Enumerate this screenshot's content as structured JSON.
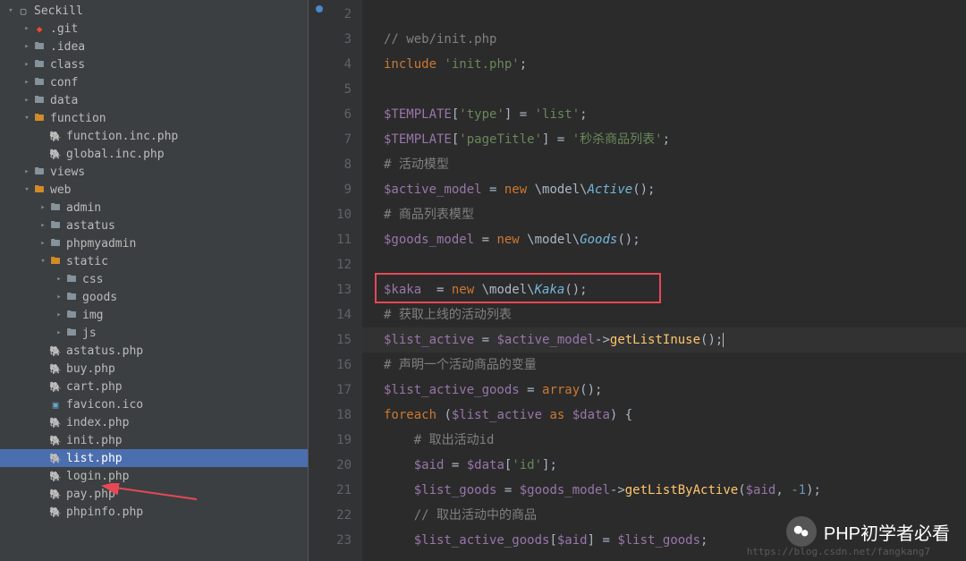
{
  "sidebar": {
    "items": [
      {
        "depth": 0,
        "chev": "open",
        "icon": "project",
        "label": "Seckill"
      },
      {
        "depth": 1,
        "chev": "closed",
        "icon": "git",
        "label": ".git"
      },
      {
        "depth": 1,
        "chev": "closed",
        "icon": "folder",
        "label": ".idea"
      },
      {
        "depth": 1,
        "chev": "closed",
        "icon": "folder",
        "label": "class"
      },
      {
        "depth": 1,
        "chev": "closed",
        "icon": "folder",
        "label": "conf"
      },
      {
        "depth": 1,
        "chev": "closed",
        "icon": "folder",
        "label": "data"
      },
      {
        "depth": 1,
        "chev": "open",
        "icon": "folder-open",
        "label": "function"
      },
      {
        "depth": 2,
        "chev": "none",
        "icon": "php",
        "label": "function.inc.php"
      },
      {
        "depth": 2,
        "chev": "none",
        "icon": "php",
        "label": "global.inc.php"
      },
      {
        "depth": 1,
        "chev": "closed",
        "icon": "folder",
        "label": "views"
      },
      {
        "depth": 1,
        "chev": "open",
        "icon": "folder-open",
        "label": "web"
      },
      {
        "depth": 2,
        "chev": "closed",
        "icon": "folder",
        "label": "admin"
      },
      {
        "depth": 2,
        "chev": "closed",
        "icon": "folder",
        "label": "astatus"
      },
      {
        "depth": 2,
        "chev": "closed",
        "icon": "folder",
        "label": "phpmyadmin"
      },
      {
        "depth": 2,
        "chev": "open",
        "icon": "folder-open",
        "label": "static"
      },
      {
        "depth": 3,
        "chev": "closed",
        "icon": "folder",
        "label": "css"
      },
      {
        "depth": 3,
        "chev": "closed",
        "icon": "folder",
        "label": "goods"
      },
      {
        "depth": 3,
        "chev": "closed",
        "icon": "folder",
        "label": "img"
      },
      {
        "depth": 3,
        "chev": "closed",
        "icon": "folder",
        "label": "js"
      },
      {
        "depth": 2,
        "chev": "none",
        "icon": "php",
        "label": "astatus.php"
      },
      {
        "depth": 2,
        "chev": "none",
        "icon": "php",
        "label": "buy.php"
      },
      {
        "depth": 2,
        "chev": "none",
        "icon": "php",
        "label": "cart.php"
      },
      {
        "depth": 2,
        "chev": "none",
        "icon": "img",
        "label": "favicon.ico"
      },
      {
        "depth": 2,
        "chev": "none",
        "icon": "php",
        "label": "index.php"
      },
      {
        "depth": 2,
        "chev": "none",
        "icon": "php",
        "label": "init.php"
      },
      {
        "depth": 2,
        "chev": "none",
        "icon": "php",
        "label": "list.php",
        "selected": true
      },
      {
        "depth": 2,
        "chev": "none",
        "icon": "php",
        "label": "login.php"
      },
      {
        "depth": 2,
        "chev": "none",
        "icon": "php",
        "label": "pay.php"
      },
      {
        "depth": 2,
        "chev": "none",
        "icon": "php",
        "label": "phpinfo.php"
      }
    ]
  },
  "gutter": {
    "start": 2,
    "end": 23,
    "modified_marker_line": 2
  },
  "code": {
    "lines": [
      {
        "n": 2,
        "tokens": []
      },
      {
        "n": 3,
        "tokens": [
          {
            "c": "t-comment",
            "t": "// web/init.php"
          }
        ]
      },
      {
        "n": 4,
        "tokens": [
          {
            "c": "t-keyword",
            "t": "include "
          },
          {
            "c": "t-string",
            "t": "'init.php'"
          },
          {
            "c": "t-punct",
            "t": ";"
          }
        ]
      },
      {
        "n": 5,
        "tokens": []
      },
      {
        "n": 6,
        "tokens": [
          {
            "c": "t-var",
            "t": "$TEMPLATE"
          },
          {
            "c": "t-punct",
            "t": "["
          },
          {
            "c": "t-string",
            "t": "'type'"
          },
          {
            "c": "t-punct",
            "t": "] = "
          },
          {
            "c": "t-string",
            "t": "'list'"
          },
          {
            "c": "t-punct",
            "t": ";"
          }
        ]
      },
      {
        "n": 7,
        "tokens": [
          {
            "c": "t-var",
            "t": "$TEMPLATE"
          },
          {
            "c": "t-punct",
            "t": "["
          },
          {
            "c": "t-string",
            "t": "'pageTitle'"
          },
          {
            "c": "t-punct",
            "t": "] = "
          },
          {
            "c": "t-string",
            "t": "'秒杀商品列表'"
          },
          {
            "c": "t-punct",
            "t": ";"
          }
        ]
      },
      {
        "n": 8,
        "tokens": [
          {
            "c": "t-comment",
            "t": "# 活动模型"
          }
        ]
      },
      {
        "n": 9,
        "tokens": [
          {
            "c": "t-var",
            "t": "$active_model"
          },
          {
            "c": "t-punct",
            "t": " = "
          },
          {
            "c": "t-keyword",
            "t": "new "
          },
          {
            "c": "t-ns",
            "t": "\\model\\"
          },
          {
            "c": "t-class",
            "t": "Active"
          },
          {
            "c": "t-punct",
            "t": "();"
          }
        ]
      },
      {
        "n": 10,
        "tokens": [
          {
            "c": "t-comment",
            "t": "# 商品列表模型"
          }
        ]
      },
      {
        "n": 11,
        "tokens": [
          {
            "c": "t-var",
            "t": "$goods_model"
          },
          {
            "c": "t-punct",
            "t": " = "
          },
          {
            "c": "t-keyword",
            "t": "new "
          },
          {
            "c": "t-ns",
            "t": "\\model\\"
          },
          {
            "c": "t-class",
            "t": "Goods"
          },
          {
            "c": "t-punct",
            "t": "();"
          }
        ]
      },
      {
        "n": 12,
        "tokens": []
      },
      {
        "n": 13,
        "tokens": [
          {
            "c": "t-var",
            "t": "$kaka"
          },
          {
            "c": "t-punct",
            "t": "  = "
          },
          {
            "c": "t-keyword",
            "t": "new "
          },
          {
            "c": "t-ns",
            "t": "\\model\\"
          },
          {
            "c": "t-class",
            "t": "Kaka"
          },
          {
            "c": "t-punct",
            "t": "();"
          }
        ],
        "highlight": true
      },
      {
        "n": 14,
        "tokens": [
          {
            "c": "t-comment",
            "t": "# 获取上线的活动列表"
          }
        ]
      },
      {
        "n": 15,
        "tokens": [
          {
            "c": "t-var",
            "t": "$list_active"
          },
          {
            "c": "t-punct",
            "t": " = "
          },
          {
            "c": "t-var",
            "t": "$active_model"
          },
          {
            "c": "t-arrow",
            "t": "->"
          },
          {
            "c": "t-func",
            "t": "getListInuse"
          },
          {
            "c": "t-punct",
            "t": "();"
          }
        ],
        "current": true
      },
      {
        "n": 16,
        "tokens": [
          {
            "c": "t-comment",
            "t": "# 声明一个活动商品的变量"
          }
        ]
      },
      {
        "n": 17,
        "tokens": [
          {
            "c": "t-var",
            "t": "$list_active_goods"
          },
          {
            "c": "t-punct",
            "t": " = "
          },
          {
            "c": "t-keyword",
            "t": "array"
          },
          {
            "c": "t-punct",
            "t": "();"
          }
        ]
      },
      {
        "n": 18,
        "tokens": [
          {
            "c": "t-keyword",
            "t": "foreach "
          },
          {
            "c": "t-punct",
            "t": "("
          },
          {
            "c": "t-var",
            "t": "$list_active"
          },
          {
            "c": "t-keyword",
            "t": " as "
          },
          {
            "c": "t-var",
            "t": "$data"
          },
          {
            "c": "t-punct",
            "t": ") {"
          }
        ]
      },
      {
        "n": 19,
        "indent": 1,
        "tokens": [
          {
            "c": "t-comment",
            "t": "# 取出活动id"
          }
        ]
      },
      {
        "n": 20,
        "indent": 1,
        "tokens": [
          {
            "c": "t-var",
            "t": "$aid"
          },
          {
            "c": "t-punct",
            "t": " = "
          },
          {
            "c": "t-var",
            "t": "$data"
          },
          {
            "c": "t-punct",
            "t": "["
          },
          {
            "c": "t-string",
            "t": "'id'"
          },
          {
            "c": "t-punct",
            "t": "];"
          }
        ]
      },
      {
        "n": 21,
        "indent": 1,
        "tokens": [
          {
            "c": "t-var",
            "t": "$list_goods"
          },
          {
            "c": "t-punct",
            "t": " = "
          },
          {
            "c": "t-var",
            "t": "$goods_model"
          },
          {
            "c": "t-arrow",
            "t": "->"
          },
          {
            "c": "t-func",
            "t": "getListByActive"
          },
          {
            "c": "t-punct",
            "t": "("
          },
          {
            "c": "t-var",
            "t": "$aid"
          },
          {
            "c": "t-punct",
            "t": ", "
          },
          {
            "c": "t-num",
            "t": "-1"
          },
          {
            "c": "t-punct",
            "t": ");"
          }
        ]
      },
      {
        "n": 22,
        "indent": 1,
        "tokens": [
          {
            "c": "t-comment",
            "t": "// 取出活动中的商品"
          }
        ]
      },
      {
        "n": 23,
        "indent": 1,
        "tokens": [
          {
            "c": "t-var",
            "t": "$list_active_goods"
          },
          {
            "c": "t-punct",
            "t": "["
          },
          {
            "c": "t-var",
            "t": "$aid"
          },
          {
            "c": "t-punct",
            "t": "] = "
          },
          {
            "c": "t-var",
            "t": "$list_goods"
          },
          {
            "c": "t-punct",
            "t": ";"
          }
        ]
      }
    ]
  },
  "watermark": {
    "text": "PHP初学者必看",
    "url": "https://blog.csdn.net/fangkang7"
  }
}
